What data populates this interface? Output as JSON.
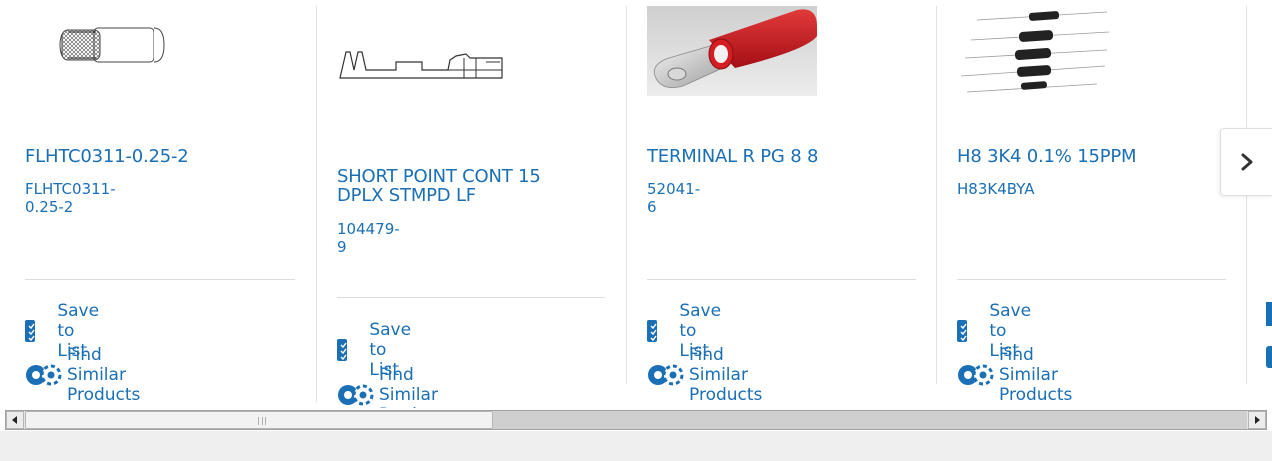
{
  "carousel": {
    "products": [
      {
        "title": "FLHTC0311-0.25-2",
        "part_number": "FLHTC0311-0.25-2",
        "image": "braided-wire-sleeve-image"
      },
      {
        "title": "SHORT POINT CONT 15 DPLX STMPD LF",
        "part_number": "104479-9",
        "image": "stamped-contact-drawing-image"
      },
      {
        "title": "TERMINAL R PG 8 8",
        "part_number": "52041-6",
        "image": "red-ring-terminal-image"
      },
      {
        "title": "H8 3K4 0.1% 15PPM",
        "part_number": "H83K4BYA",
        "image": "axial-resistors-image"
      }
    ],
    "save_label": "Save to List",
    "find_label": "Find Similar Products",
    "next_icon": "chevron-right-icon"
  },
  "colors": {
    "link": "#1a6fb5",
    "divider": "#dcdcdc",
    "terminal_red": "#c8141c"
  }
}
